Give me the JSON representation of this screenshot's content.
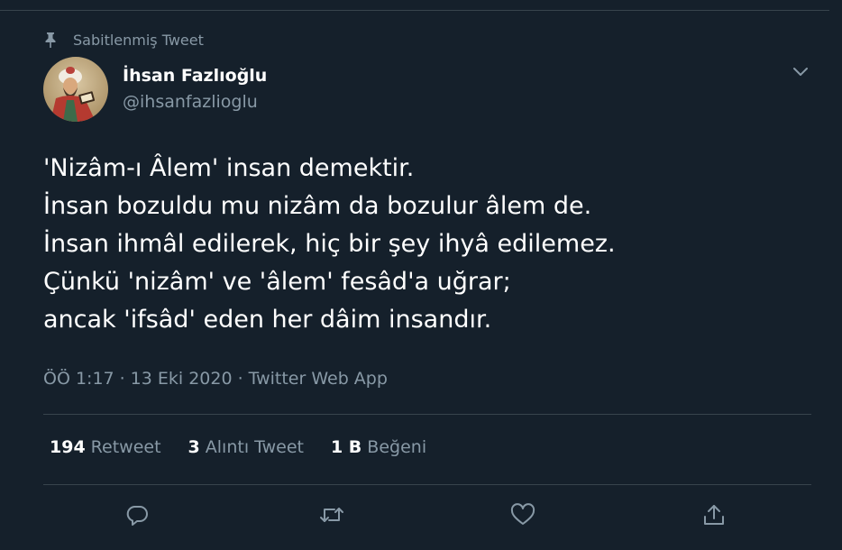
{
  "pinned": {
    "label": "Sabitlenmiş Tweet",
    "icon": "pin-icon"
  },
  "author": {
    "display_name": "İhsan Fazlıoğlu",
    "handle": "@ihsanfazlioglu",
    "avatar_icon": "avatar-portrait"
  },
  "menu": {
    "icon": "chevron-down-icon"
  },
  "tweet": {
    "lines": [
      "'Nizâm-ı Âlem' insan demektir.",
      "İnsan bozuldu mu nizâm da bozulur âlem de.",
      "İnsan ihmâl edilerek, hiç bir şey ihyâ edilemez.",
      "Çünkü 'nizâm' ve 'âlem' fesâd'a uğrar;",
      "ancak 'ifsâd' eden her dâim insandır."
    ]
  },
  "meta": {
    "time": "ÖÖ 1:17",
    "separator": "·",
    "date": "13 Eki 2020",
    "source": "Twitter Web App"
  },
  "stats": {
    "retweets": {
      "count": "194",
      "label": "Retweet"
    },
    "quotes": {
      "count": "3",
      "label": "Alıntı Tweet"
    },
    "likes": {
      "count": "1 B",
      "label": "Beğeni"
    }
  },
  "actions": [
    {
      "name": "reply",
      "icon": "reply-icon"
    },
    {
      "name": "retweet",
      "icon": "retweet-icon"
    },
    {
      "name": "like",
      "icon": "heart-icon"
    },
    {
      "name": "share",
      "icon": "share-icon"
    }
  ],
  "colors": {
    "background": "#15202b",
    "text_primary": "#ffffff",
    "text_secondary": "#8899a6",
    "divider": "#38444d"
  }
}
